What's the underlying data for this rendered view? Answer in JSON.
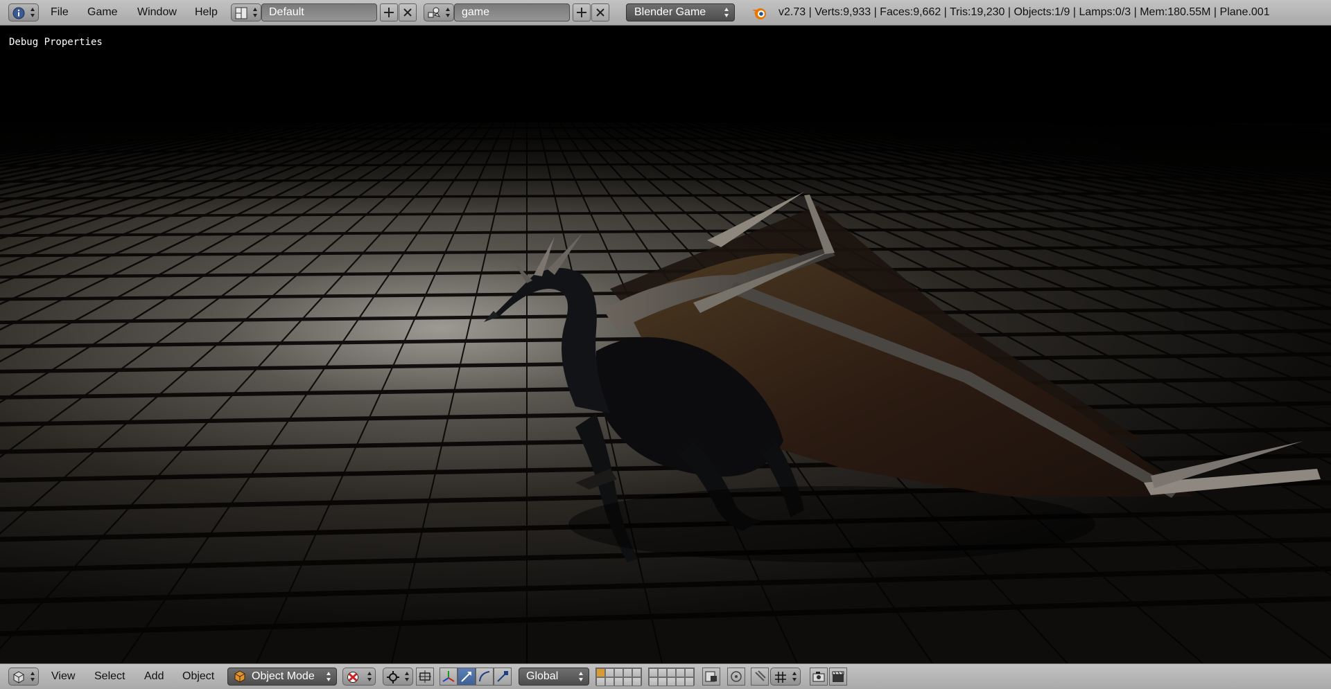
{
  "top_header": {
    "menu": [
      "File",
      "Game",
      "Window",
      "Help"
    ],
    "screen_layout": "Default",
    "scene": "game",
    "render_engine": "Blender Game",
    "stats": "v2.73 | Verts:9,933 | Faces:9,662 | Tris:19,230 | Objects:1/9 | Lamps:0/3 | Mem:180.55M | Plane.001"
  },
  "viewport": {
    "overlay_text": "Debug Properties"
  },
  "bottom_header": {
    "menu": [
      "View",
      "Select",
      "Add",
      "Object"
    ],
    "mode": "Object Mode",
    "transform_orientation": "Global"
  },
  "icons": {
    "info_editor": "info-icon",
    "screen_layout": "layout-icon",
    "scene": "scene-icon",
    "blender_logo": "blender-logo-icon",
    "view3d_editor": "view3d-icon",
    "object_mode": "cube-icon",
    "viewport_shading": "shading-icon",
    "pivot": "pivot-icon",
    "manipulator": "manipulator-icon",
    "translate": "translate-icon",
    "rotate": "rotate-icon",
    "scale": "scale-icon"
  },
  "colors": {
    "header_bg": "#b4b4b4",
    "dropdown_dark": "#5a5a5a",
    "active_tool": "#4a6ea8",
    "layer_active": "#d99a34"
  }
}
